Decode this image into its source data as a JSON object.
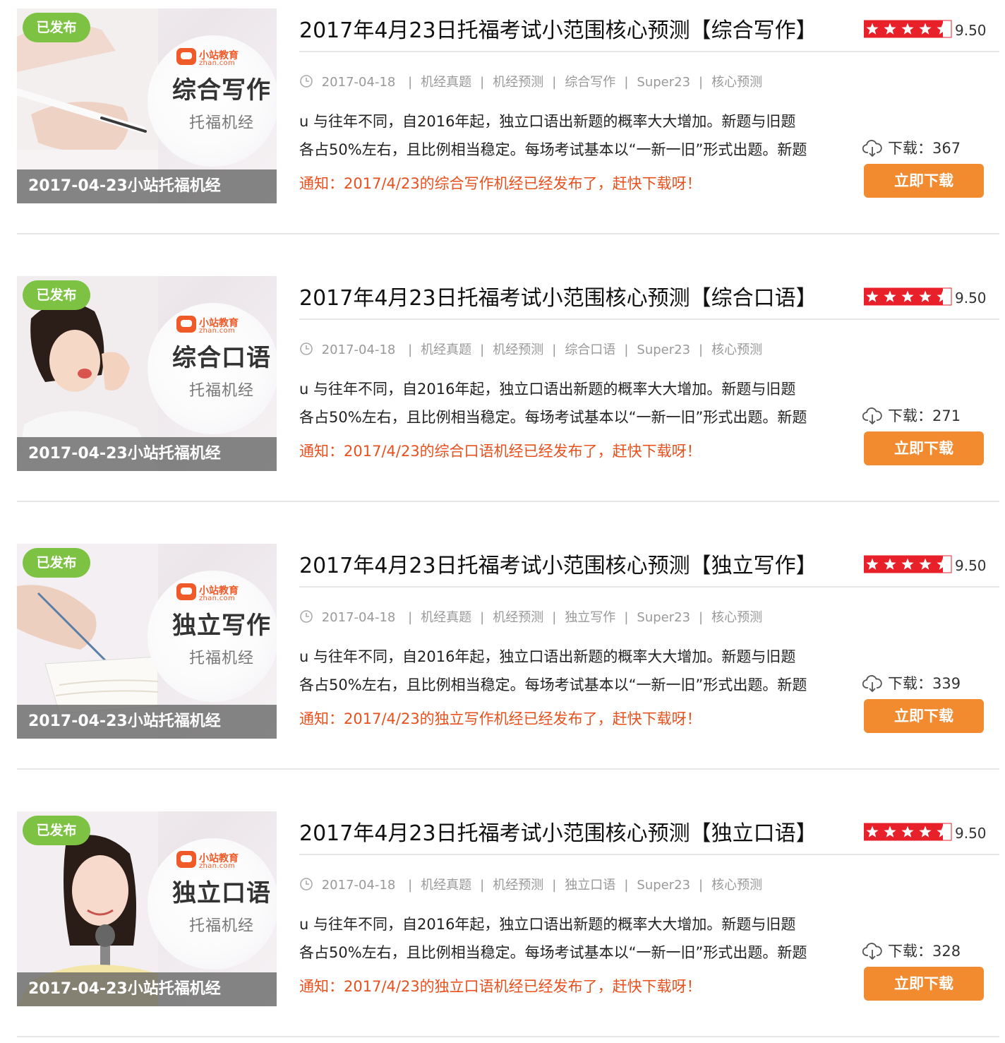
{
  "accent_colors": {
    "badge_green": "#7dc242",
    "button_orange": "#f28a30",
    "notice_red": "#e8501e",
    "star_red": "#e8202a",
    "brand_orange": "#f05a28"
  },
  "items": [
    {
      "badge": "已发布",
      "brand_name": "小站教育",
      "brand_domain": "zhan.com",
      "thumb_big": "综合写作",
      "thumb_small": "托福机经",
      "thumb_caption": "2017-04-23小站托福机经",
      "thumb_scene": "pen-hand",
      "title": "2017年4月23日托福考试小范围核心预测【综合写作】",
      "rating_stars": 4.5,
      "rating_score": "9.50",
      "date": "2017-04-18",
      "tags": [
        "机经真题",
        "机经预测",
        "综合写作",
        "Super23",
        "核心预测"
      ],
      "desc_line1": "u 与往年不同，自2016年起，独立口语出新题的概率大大增加。新题与旧题",
      "desc_line2": "各占50%左右，且比例相当稳定。每场考试基本以“一新一旧”形式出题。新题",
      "notice": "通知：2017/4/23的综合写作机经已经发布了，赶快下载呀！",
      "downloads_label": "下载：",
      "downloads_count": "367",
      "button_label": "立即下载"
    },
    {
      "badge": "已发布",
      "brand_name": "小站教育",
      "brand_domain": "zhan.com",
      "thumb_big": "综合口语",
      "thumb_small": "托福机经",
      "thumb_caption": "2017-04-23小站托福机经",
      "thumb_scene": "woman-calling",
      "title": "2017年4月23日托福考试小范围核心预测【综合口语】",
      "rating_stars": 4.5,
      "rating_score": "9.50",
      "date": "2017-04-18",
      "tags": [
        "机经真题",
        "机经预测",
        "综合口语",
        "Super23",
        "核心预测"
      ],
      "desc_line1": "u 与往年不同，自2016年起，独立口语出新题的概率大大增加。新题与旧题",
      "desc_line2": "各占50%左右，且比例相当稳定。每场考试基本以“一新一旧”形式出题。新题",
      "notice": "通知：2017/4/23的综合口语机经已经发布了，赶快下载呀！",
      "downloads_label": "下载：",
      "downloads_count": "271",
      "button_label": "立即下载"
    },
    {
      "badge": "已发布",
      "brand_name": "小站教育",
      "brand_domain": "zhan.com",
      "thumb_big": "独立写作",
      "thumb_small": "托福机经",
      "thumb_caption": "2017-04-23小站托福机经",
      "thumb_scene": "writing-notebook",
      "title": "2017年4月23日托福考试小范围核心预测【独立写作】",
      "rating_stars": 4.5,
      "rating_score": "9.50",
      "date": "2017-04-18",
      "tags": [
        "机经真题",
        "机经预测",
        "独立写作",
        "Super23",
        "核心预测"
      ],
      "desc_line1": "u 与往年不同，自2016年起，独立口语出新题的概率大大增加。新题与旧题",
      "desc_line2": "各占50%左右，且比例相当稳定。每场考试基本以“一新一旧”形式出题。新题",
      "notice": "通知：2017/4/23的独立写作机经已经发布了，赶快下载呀！",
      "downloads_label": "下载：",
      "downloads_count": "339",
      "button_label": "立即下载"
    },
    {
      "badge": "已发布",
      "brand_name": "小站教育",
      "brand_domain": "zhan.com",
      "thumb_big": "独立口语",
      "thumb_small": "托福机经",
      "thumb_caption": "2017-04-23小站托福机经",
      "thumb_scene": "woman-microphone",
      "title": "2017年4月23日托福考试小范围核心预测【独立口语】",
      "rating_stars": 4.5,
      "rating_score": "9.50",
      "date": "2017-04-18",
      "tags": [
        "机经真题",
        "机经预测",
        "独立口语",
        "Super23",
        "核心预测"
      ],
      "desc_line1": "u 与往年不同，自2016年起，独立口语出新题的概率大大增加。新题与旧题",
      "desc_line2": "各占50%左右，且比例相当稳定。每场考试基本以“一新一旧”形式出题。新题",
      "notice": "通知：2017/4/23的独立口语机经已经发布了，赶快下载呀！",
      "downloads_label": "下载：",
      "downloads_count": "328",
      "button_label": "立即下载"
    }
  ]
}
